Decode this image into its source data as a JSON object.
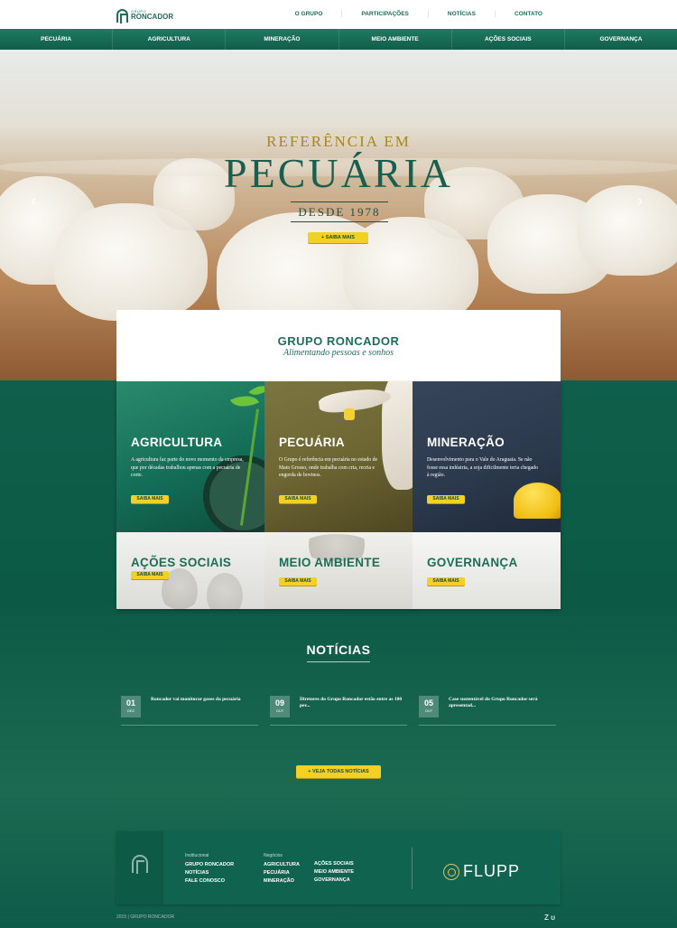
{
  "header": {
    "logo_small": "GRUPO",
    "logo_big": "RONCADOR",
    "nav": [
      "O GRUPO",
      "PARTICIPAÇÕES",
      "NOTÍCIAS",
      "CONTATO"
    ]
  },
  "section_nav": [
    "PECUÁRIA",
    "AGRICULTURA",
    "MINERAÇÃO",
    "MEIO AMBIENTE",
    "AÇÕES SOCIAIS",
    "GOVERNANÇA"
  ],
  "hero": {
    "title_small": "REFERÊNCIA EM",
    "title_big": "PECUÁRIA",
    "subtitle": "DESDE 1978",
    "button": "+   SAIBA MAIS",
    "arrow_left": "‹",
    "arrow_right": "›"
  },
  "intro": {
    "title": "GRUPO RONCADOR",
    "subtitle": "Alimentando pessoas e sonhos"
  },
  "tiles": {
    "agricultura": {
      "title": "AGRICULTURA",
      "text": "A agricultura faz parte do novo momento da empresa, que por décadas trabalhou apenas com a pecuária de corte.",
      "button": "SAIBA MAIS"
    },
    "pecuaria": {
      "title": "PECUÁRIA",
      "text": "O Grupo é referência em pecuária no estado de Mato Grosso, onde trabalha com cria, recria e engorda de bovinos.",
      "button": "SAIBA MAIS"
    },
    "mineracao": {
      "title": "MINERAÇÃO",
      "text": "Desenvolvimento para o Vale do Araguaia. Se não fosse essa indústria, a soja dificilmente teria chegado à região.",
      "button": "SAIBA MAIS"
    },
    "acoes": {
      "title": "AÇÕES SOCIAIS",
      "button": "SAIBA MAIS"
    },
    "meio": {
      "title": "MEIO AMBIENTE",
      "button": "SAIBA MAIS"
    },
    "gov": {
      "title": "GOVERNANÇA",
      "button": "SAIBA MAIS"
    }
  },
  "news": {
    "title": "NOTÍCIAS",
    "items": [
      {
        "day": "01",
        "month": "DEZ",
        "text": "Roncador vai monitorar gases da pecuária"
      },
      {
        "day": "09",
        "month": "OUT",
        "text": "Diretores do Grupo Roncador estão entre as 100 per..."
      },
      {
        "day": "05",
        "month": "OUT",
        "text": "Case sustentável do Grupo Roncador será apresentad..."
      }
    ],
    "button": "+      VEJA TODAS NOTÍCIAS"
  },
  "footer": {
    "col1_head": "Institucional",
    "col1_links": [
      "GRUPO RONCADOR",
      "NOTÍCIAS",
      "FALE CONOSCO"
    ],
    "col2_head": "Negócios",
    "col2_links": [
      "AGRICULTURA",
      "PECUÁRIA",
      "MINERAÇÃO"
    ],
    "col3_links": [
      "AÇÕES SOCIAIS",
      "MEIO AMBIENTE",
      "GOVERNANÇA"
    ],
    "partner": "FLUPP",
    "copyright": "2015 | GRUPO RONCADOR",
    "credits": "Z ʊ"
  },
  "colors": {
    "brand_green": "#1c6e58",
    "accent_yellow": "#f2d025",
    "gold": "#a8861d"
  }
}
